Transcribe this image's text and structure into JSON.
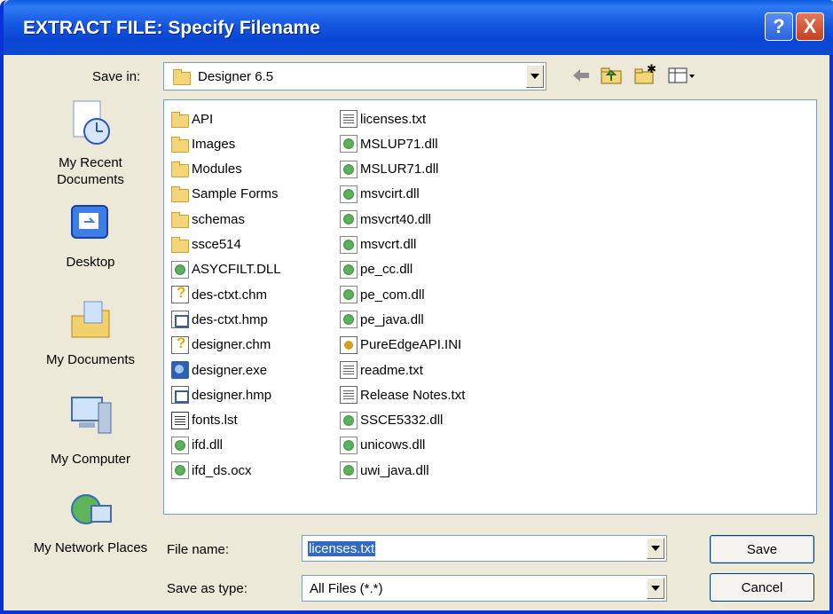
{
  "window": {
    "title": "EXTRACT FILE: Specify Filename"
  },
  "title_buttons": {
    "help": "?",
    "close": "X"
  },
  "save_in": {
    "label": "Save in:",
    "value": "Designer 6.5"
  },
  "toolbar_icons": [
    "back-arrow-icon",
    "up-folder-icon",
    "new-folder-icon",
    "view-menu-icon"
  ],
  "places": [
    {
      "label": "My Recent Documents",
      "icon": "recent-documents-icon"
    },
    {
      "label": "Desktop",
      "icon": "desktop-icon"
    },
    {
      "label": "My Documents",
      "icon": "my-documents-icon"
    },
    {
      "label": "My Computer",
      "icon": "my-computer-icon"
    },
    {
      "label": "My Network Places",
      "icon": "network-places-icon"
    }
  ],
  "files_col1": [
    {
      "name": "API",
      "type": "folder"
    },
    {
      "name": "Images",
      "type": "folder"
    },
    {
      "name": "Modules",
      "type": "folder"
    },
    {
      "name": "Sample Forms",
      "type": "folder"
    },
    {
      "name": "schemas",
      "type": "folder"
    },
    {
      "name": "ssce514",
      "type": "folder"
    },
    {
      "name": "ASYCFILT.DLL",
      "type": "dll"
    },
    {
      "name": "des-ctxt.chm",
      "type": "chm"
    },
    {
      "name": "des-ctxt.hmp",
      "type": "hmp"
    },
    {
      "name": "designer.chm",
      "type": "chm"
    },
    {
      "name": "designer.exe",
      "type": "exe"
    },
    {
      "name": "designer.hmp",
      "type": "hmp"
    },
    {
      "name": "fonts.lst",
      "type": "lst"
    },
    {
      "name": "ifd.dll",
      "type": "dll"
    },
    {
      "name": "ifd_ds.ocx",
      "type": "dll"
    }
  ],
  "files_col2": [
    {
      "name": "licenses.txt",
      "type": "txt"
    },
    {
      "name": "MSLUP71.dll",
      "type": "dll"
    },
    {
      "name": "MSLUR71.dll",
      "type": "dll"
    },
    {
      "name": "msvcirt.dll",
      "type": "dll"
    },
    {
      "name": "msvcrt40.dll",
      "type": "dll"
    },
    {
      "name": "msvcrt.dll",
      "type": "dll"
    },
    {
      "name": "pe_cc.dll",
      "type": "dll"
    },
    {
      "name": "pe_com.dll",
      "type": "dll"
    },
    {
      "name": "pe_java.dll",
      "type": "dll"
    },
    {
      "name": "PureEdgeAPI.INI",
      "type": "ini"
    },
    {
      "name": "readme.txt",
      "type": "txt"
    },
    {
      "name": "Release Notes.txt",
      "type": "txt"
    },
    {
      "name": "SSCE5332.dll",
      "type": "dll"
    },
    {
      "name": "unicows.dll",
      "type": "dll"
    },
    {
      "name": "uwi_java.dll",
      "type": "dll"
    }
  ],
  "file_name": {
    "label": "File name:",
    "value": "licenses.txt"
  },
  "save_as_type": {
    "label": "Save as type:",
    "value": "All Files (*.*)"
  },
  "buttons": {
    "save": "Save",
    "cancel": "Cancel"
  }
}
